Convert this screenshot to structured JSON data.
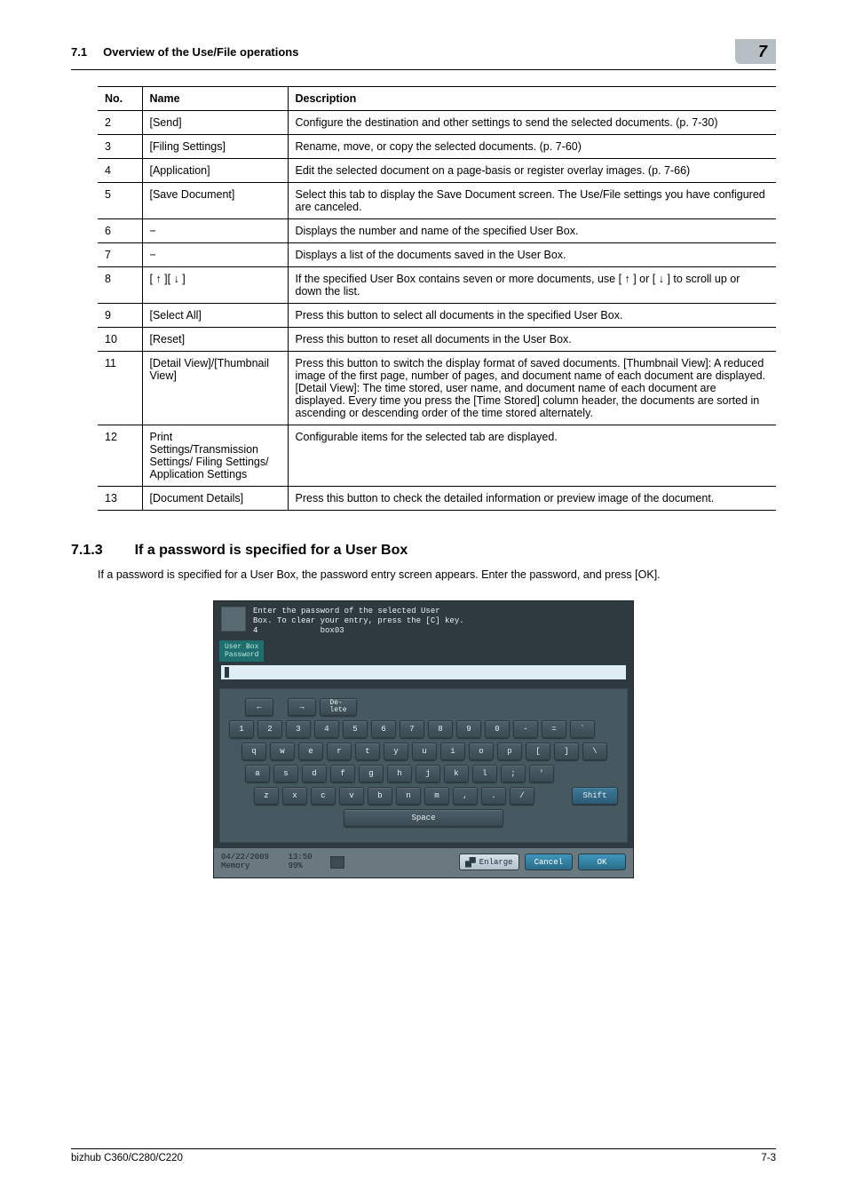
{
  "header": {
    "section_no": "7.1",
    "section_title": "Overview of the Use/File operations",
    "chapter": "7"
  },
  "table": {
    "headers": [
      "No.",
      "Name",
      "Description"
    ],
    "rows": [
      {
        "no": "2",
        "name": "[Send]",
        "desc": "Configure the destination and other settings to send the selected documents. (p. 7-30)"
      },
      {
        "no": "3",
        "name": "[Filing Settings]",
        "desc": "Rename, move, or copy the selected documents. (p. 7-60)"
      },
      {
        "no": "4",
        "name": "[Application]",
        "desc": "Edit the selected document on a page-basis or register overlay images. (p. 7-66)"
      },
      {
        "no": "5",
        "name": "[Save Document]",
        "desc": "Select this tab to display the Save Document screen. The Use/File settings you have configured are canceled."
      },
      {
        "no": "6",
        "name": "−",
        "desc": "Displays the number and name of the specified User Box."
      },
      {
        "no": "7",
        "name": "−",
        "desc": "Displays a list of the documents saved in the User Box."
      },
      {
        "no": "8",
        "name": "[ ↑ ][ ↓ ]",
        "desc": "If the specified User Box contains seven or more documents, use [ ↑ ] or [ ↓ ] to scroll up or down the list."
      },
      {
        "no": "9",
        "name": "[Select All]",
        "desc": "Press this button to select all documents in the specified User Box."
      },
      {
        "no": "10",
        "name": "[Reset]",
        "desc": "Press this button to reset all documents in the User Box."
      },
      {
        "no": "11",
        "name": "[Detail View]/[Thumbnail View]",
        "desc": "Press this button to switch the display format of saved documents. [Thumbnail View]: A reduced image of the first page, number of pages, and document name of each document are displayed. [Detail View]: The time stored, user name, and document name of each document are displayed. Every time you press the [Time Stored] column header, the documents are sorted in ascending or descending order of the time stored alternately."
      },
      {
        "no": "12",
        "name": "Print Settings/Transmission Settings/ Filing Settings/ Application Settings",
        "desc": "Configurable items for the selected tab are displayed."
      },
      {
        "no": "13",
        "name": "[Document Details]",
        "desc": "Press this button to check the detailed information or preview image of the document."
      }
    ]
  },
  "subsection": {
    "no": "7.1.3",
    "title": "If a password is specified for a User Box",
    "body": "If a password is specified for a User Box, the password entry screen appears. Enter the password, and press [OK]."
  },
  "mfp": {
    "instr_line1": "Enter the password of the selected User",
    "instr_line2": "Box. To clear your entry, press the [C] key.",
    "box_no": "4",
    "box_name": "box03",
    "side_label": "User Box\nPassword",
    "delete": "De-\nlete",
    "rows": {
      "r1": [
        "1",
        "2",
        "3",
        "4",
        "5",
        "6",
        "7",
        "8",
        "9",
        "0",
        "-",
        "=",
        "`"
      ],
      "r2": [
        "q",
        "w",
        "e",
        "r",
        "t",
        "y",
        "u",
        "i",
        "o",
        "p",
        "[",
        "]",
        "\\"
      ],
      "r3": [
        "a",
        "s",
        "d",
        "f",
        "g",
        "h",
        "j",
        "k",
        "l",
        ";",
        "'"
      ],
      "r4": [
        "z",
        "x",
        "c",
        "v",
        "b",
        "n",
        "m",
        ",",
        ".",
        "/"
      ]
    },
    "space": "Space",
    "shift": "Shift",
    "status_date": "04/22/2009",
    "status_time": "13:50",
    "status_mem": "Memory",
    "status_pct": "99%",
    "enlarge": "Enlarge",
    "cancel": "Cancel",
    "ok": "OK"
  },
  "footer": {
    "left": "bizhub C360/C280/C220",
    "right": "7-3"
  }
}
